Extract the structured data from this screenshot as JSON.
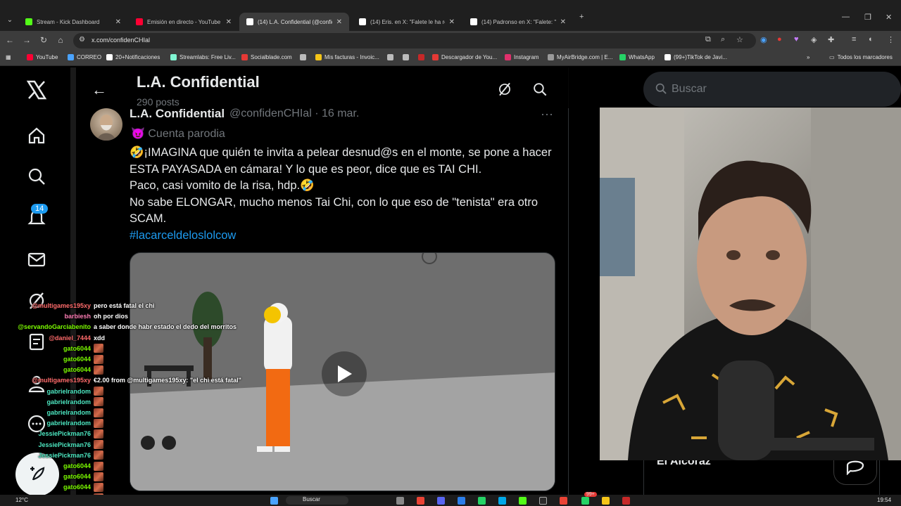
{
  "browser": {
    "tabs": [
      {
        "title": "Stream - Kick Dashboard",
        "color": "#53fc18",
        "active": false
      },
      {
        "title": "Emisión en directo - YouTube S",
        "color": "#ff0033",
        "active": false
      },
      {
        "title": "(14) L.A. Confidential (@confide",
        "color": "#ffffff",
        "active": true
      },
      {
        "title": "(14) Eris. en X: \"Falete le ha re",
        "color": "#ffffff",
        "active": false
      },
      {
        "title": "(14) Padronso en X: \"Falete: \"se",
        "color": "#ffffff",
        "active": false
      }
    ],
    "url": "x.com/confidenCHIal",
    "bookmarks": [
      {
        "label": "YouTube",
        "color": "#ff0033"
      },
      {
        "label": "CORREO",
        "color": "#4aa3ff"
      },
      {
        "label": "20+Notificaciones",
        "color": "#ffffff"
      },
      {
        "label": "Streamlabs: Free Liv...",
        "color": "#80f5d2"
      },
      {
        "label": "Socialblade.com",
        "color": "#e53935"
      },
      {
        "label": "",
        "color": "#bbbbbb"
      },
      {
        "label": "Mis facturas - Invoic...",
        "color": "#f5c518"
      },
      {
        "label": "",
        "color": "#bbbbbb"
      },
      {
        "label": "",
        "color": "#bbbbbb"
      },
      {
        "label": "",
        "color": "#c62828"
      },
      {
        "label": "Descargador de You...",
        "color": "#e53935"
      },
      {
        "label": "Instagram",
        "color": "#e1306c"
      },
      {
        "label": "MyAirBridge.com | E...",
        "color": "#999999"
      },
      {
        "label": "WhatsApp",
        "color": "#25d366"
      },
      {
        "label": "(99+)TikTok de Javi...",
        "color": "#ffffff"
      }
    ],
    "all_bookmarks": "Todos los marcadores"
  },
  "profile": {
    "title": "L.A. Confidential",
    "posts_count": "290 posts",
    "notifications_badge": "14"
  },
  "post": {
    "name": "L.A. Confidential",
    "handle": "@confidenCHIal · 16 mar.",
    "parody_label": "Cuenta parodia",
    "parody_emoji": "😈",
    "lines": [
      "🤣¡IMAGINA que quién te invita a pelear desnud@s en el monte, se pone a hacer ESTA PAYASADA en cámara! Y lo que es peor, dice que es TAI CHI.",
      "Paco, casi vomito de la risa, hdp.🤣",
      "No sabe ELONGAR, mucho menos Tai Chi, con lo que eso de \"tenista\" era otro SCAM."
    ],
    "hashtag": "#lacarceldeloslolcow"
  },
  "sidebar": {
    "search_placeholder": "Buscar",
    "trend_partial": "El Alcoraz"
  },
  "chat": [
    {
      "user": "@multigames195xy",
      "msg": "pero está fatal el chi",
      "color": "#ff6b6b",
      "emote": false
    },
    {
      "user": "barbiesh",
      "msg": "oh por dios",
      "color": "#ff7eb6",
      "emote": false
    },
    {
      "user": "@servandoGarciabenito",
      "msg": "a saber donde habr estado el dedo del morritos",
      "color": "#7cfc00",
      "emote": false
    },
    {
      "user": "@daniel_7444",
      "msg": "xdd",
      "color": "#ff6b6b",
      "emote": false
    },
    {
      "user": "gato6044",
      "msg": "",
      "color": "#7cfc00",
      "emote": true
    },
    {
      "user": "gato6044",
      "msg": "",
      "color": "#7cfc00",
      "emote": true
    },
    {
      "user": "gato6044",
      "msg": "",
      "color": "#7cfc00",
      "emote": true
    },
    {
      "user": "@multigames195xy",
      "msg": "€2.00 from @multigames195xy: \"el chi está fatal\"",
      "color": "#ff6b6b",
      "emote": false
    },
    {
      "user": "gabrielrandom",
      "msg": "",
      "color": "#4de8c2",
      "emote": true
    },
    {
      "user": "gabrielrandom",
      "msg": "",
      "color": "#4de8c2",
      "emote": true
    },
    {
      "user": "gabrielrandom",
      "msg": "",
      "color": "#4de8c2",
      "emote": true
    },
    {
      "user": "gabrielrandom",
      "msg": "",
      "color": "#4de8c2",
      "emote": true
    },
    {
      "user": "JessiePickman76",
      "msg": "",
      "color": "#4de8c2",
      "emote": true
    },
    {
      "user": "JessiePickman76",
      "msg": "",
      "color": "#4de8c2",
      "emote": true
    },
    {
      "user": "JessiePickman76",
      "msg": "",
      "color": "#4de8c2",
      "emote": true
    },
    {
      "user": "gato6044",
      "msg": "",
      "color": "#7cfc00",
      "emote": true
    },
    {
      "user": "gato6044",
      "msg": "",
      "color": "#7cfc00",
      "emote": true
    },
    {
      "user": "gato6044",
      "msg": "",
      "color": "#7cfc00",
      "emote": true
    },
    {
      "user": "gato6044",
      "msg": "",
      "color": "#7cfc00",
      "emote": true
    }
  ],
  "taskbar": {
    "weather": "12°C",
    "search": "Buscar",
    "time": "19:54",
    "badge": "99+"
  }
}
